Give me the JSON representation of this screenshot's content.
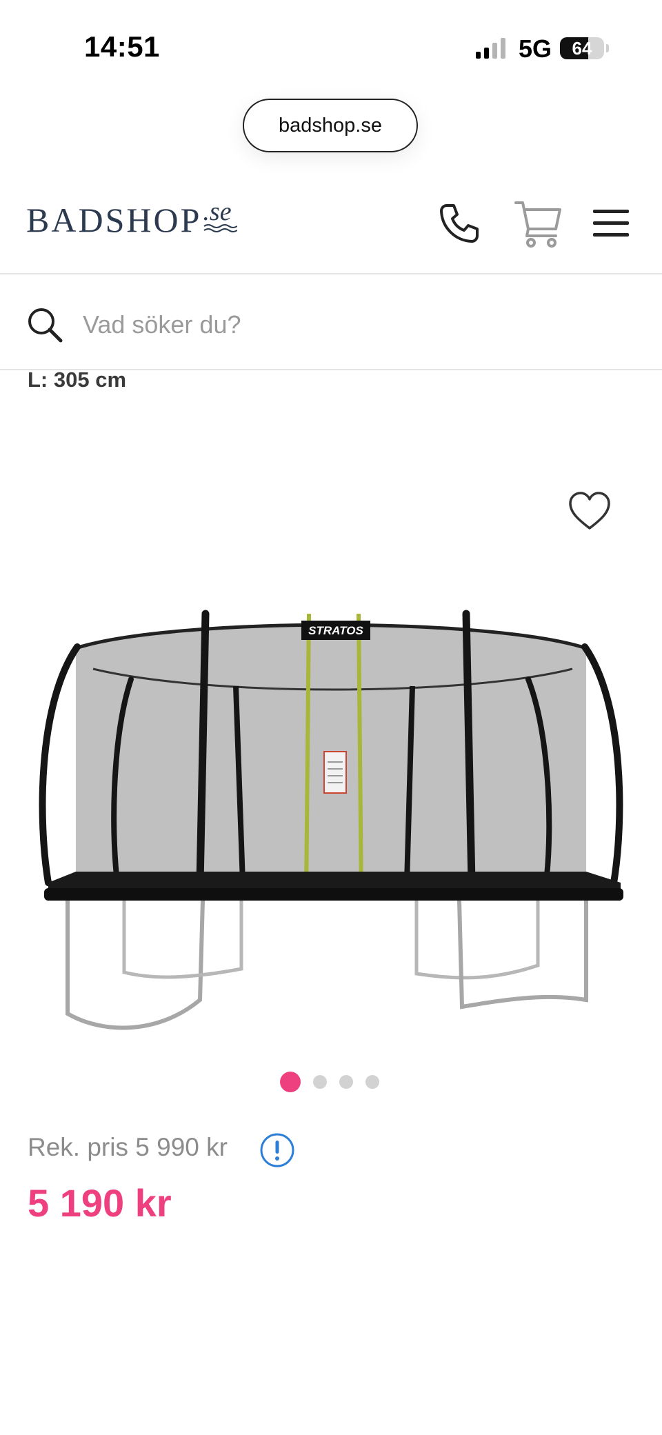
{
  "status_bar": {
    "time": "14:51",
    "network": "5G",
    "battery_level": "64"
  },
  "browser": {
    "url": "badshop.se"
  },
  "header": {
    "logo_main": "BADSHOP",
    "logo_suffix": ".se"
  },
  "search": {
    "placeholder": "Vad söker du?"
  },
  "product": {
    "dimension": "L: 305 cm",
    "image_brand": "STRATOS",
    "gallery": {
      "count": 4,
      "active_index": 0
    },
    "recommended_price": "Rek. pris 5 990 kr",
    "price": "5 190 kr"
  },
  "colors": {
    "accent": "#ee3f7f",
    "logo": "#2b3a4f",
    "info": "#2b7fd6"
  }
}
